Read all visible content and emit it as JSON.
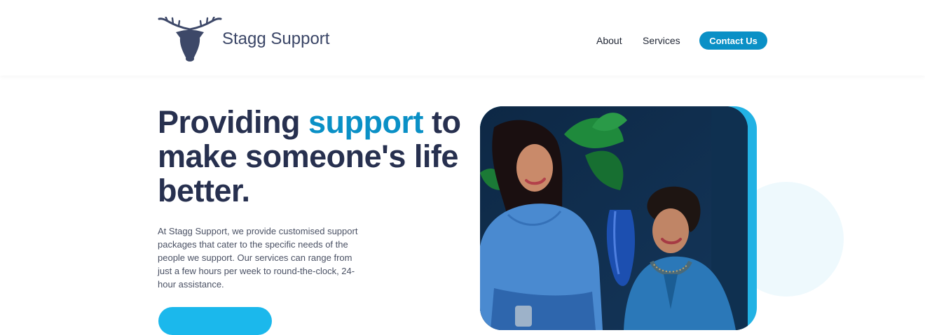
{
  "brand": {
    "name": "Stagg Support",
    "logo_icon": "stag-head-icon"
  },
  "nav": {
    "about": "About",
    "services": "Services",
    "contact": "Contact Us"
  },
  "hero": {
    "headline_pre": "Providing ",
    "headline_accent": "support",
    "headline_post": " to make someone's life better.",
    "intro": "At Stagg Support, we provide customised support packages that cater to the specific needs of the people we support. Our services can range from just a few hours per week to round-the-clock, 24-hour assistance.",
    "cta_label": ""
  },
  "colors": {
    "accent": "#0a90c6",
    "heading": "#27304f",
    "cta": "#1bb8ec",
    "photo_frame": "#22b2e4"
  }
}
